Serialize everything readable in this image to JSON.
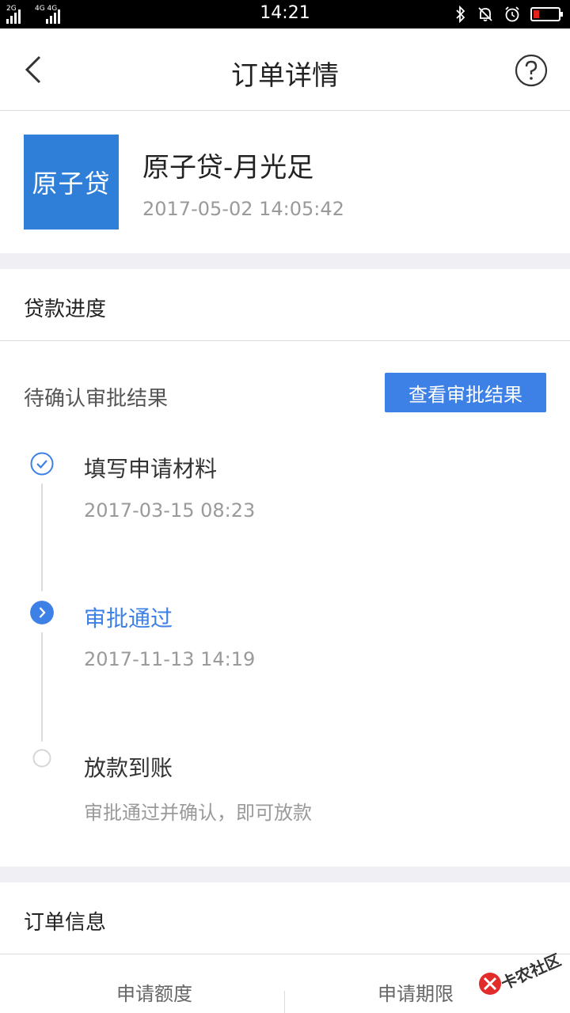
{
  "status_bar": {
    "time": "14:21",
    "network_1": "2G",
    "network_2": "4G 4G"
  },
  "nav": {
    "title": "订单详情"
  },
  "product": {
    "logo_text": "原子贷",
    "name": "原子贷-月光足",
    "datetime": "2017-05-02 14:05:42",
    "brand_color": "#2f7fd8"
  },
  "progress": {
    "section_title": "贷款进度",
    "status": "待确认审批结果",
    "view_button": "查看审批结果",
    "steps": [
      {
        "title": "填写申请材料",
        "sub": "2017-03-15 08:23",
        "state": "done"
      },
      {
        "title": "审批通过",
        "sub": "2017-11-13 14:19",
        "state": "current"
      },
      {
        "title": "放款到账",
        "sub": "审批通过并确认，即可放款",
        "state": "pending"
      }
    ],
    "accent_color": "#3d80e6"
  },
  "order_info": {
    "section_title": "订单信息",
    "col_1": "申请额度",
    "col_2": "申请期限"
  },
  "watermark": {
    "text": "卡农社区"
  }
}
